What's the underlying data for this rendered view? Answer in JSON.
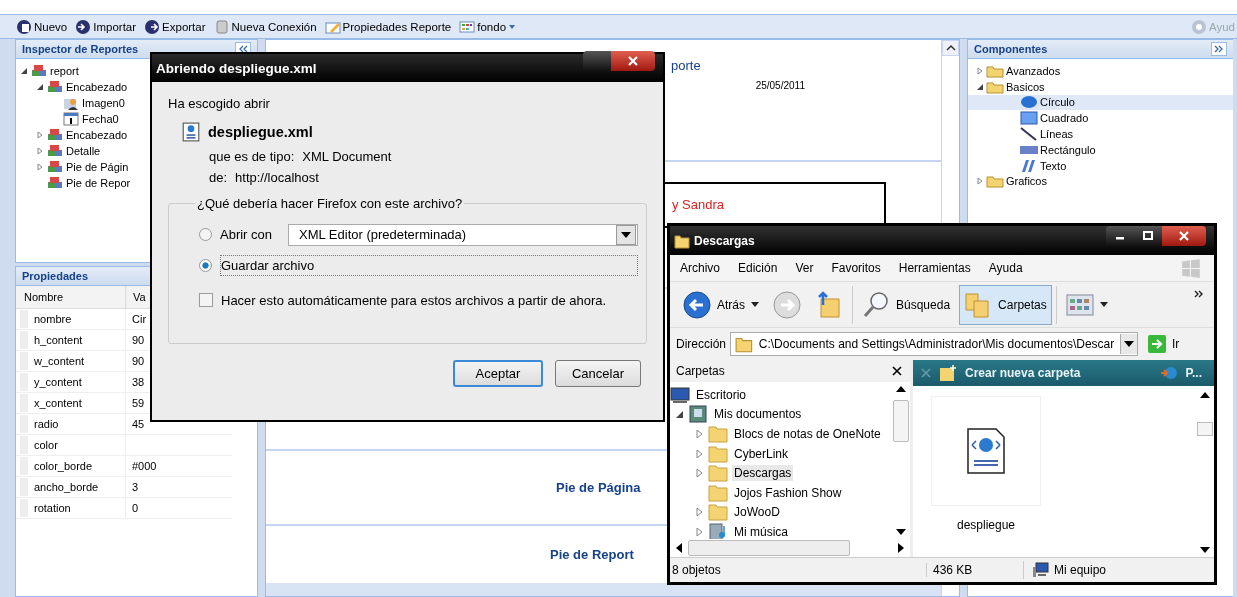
{
  "toolbar": {
    "items": [
      {
        "label": "Nuevo",
        "kind": "new"
      },
      {
        "label": "Importar",
        "kind": "import"
      },
      {
        "label": "Exportar",
        "kind": "export"
      },
      {
        "label": "Nueva Conexión",
        "kind": "connection"
      },
      {
        "label": "Propiedades Reporte",
        "kind": "properties"
      },
      {
        "label": "fondo",
        "kind": "background",
        "dropdown": true
      }
    ],
    "help": "Ayud"
  },
  "inspector": {
    "title": "Inspector de Reportes",
    "tree": [
      {
        "label": "report",
        "kind": "section",
        "expanded": true,
        "children": [
          {
            "label": "Encabezado",
            "kind": "section",
            "expanded": true,
            "children": [
              {
                "label": "Imagen0",
                "kind": "image"
              },
              {
                "label": "Fecha0",
                "kind": "date"
              }
            ]
          },
          {
            "label": "Encabezado",
            "kind": "section",
            "expanded": false
          },
          {
            "label": "Detalle",
            "kind": "section",
            "expanded": false
          },
          {
            "label": "Pie de Págin",
            "kind": "section",
            "expanded": false
          },
          {
            "label": "Pie de Repor",
            "kind": "section"
          }
        ]
      }
    ]
  },
  "properties": {
    "title": "Propiedades",
    "columns": [
      "Nombre",
      "Va"
    ],
    "rows": [
      {
        "name": "nombre",
        "value": "Cir"
      },
      {
        "name": "h_content",
        "value": "90"
      },
      {
        "name": "w_content",
        "value": "90"
      },
      {
        "name": "y_content",
        "value": "38"
      },
      {
        "name": "x_content",
        "value": "59"
      },
      {
        "name": "radio",
        "value": "45"
      },
      {
        "name": "color"
      },
      {
        "name": "color_borde",
        "value": "#000"
      },
      {
        "name": "ancho_borde",
        "value": "3"
      },
      {
        "name": "rotation",
        "value": "0"
      }
    ]
  },
  "canvas": {
    "title": "porte",
    "date": "25/05/2011",
    "box_text": "y Sandra",
    "footers": [
      "Pie de Página",
      "Pie de Report"
    ]
  },
  "components": {
    "title": "Componentes",
    "tree": [
      {
        "label": "Avanzados",
        "kind": "folder",
        "expanded": false
      },
      {
        "label": "Basicos",
        "kind": "folder",
        "expanded": true,
        "children": [
          {
            "label": "Círculo",
            "kind": "circle",
            "selected": true
          },
          {
            "label": "Cuadrado",
            "kind": "square",
            "selected": false
          },
          {
            "label": "Líneas",
            "kind": "line",
            "selected": false
          },
          {
            "label": "Rectángulo",
            "kind": "rect",
            "selected": false
          },
          {
            "label": "Texto",
            "kind": "text",
            "selected": false
          }
        ]
      },
      {
        "label": "Graficos",
        "kind": "folder",
        "expanded": false
      }
    ]
  },
  "dialog": {
    "title": "Abriendo despliegue.xml",
    "intro": "Ha escogido abrir",
    "filename": "despliegue.xml",
    "type_label": "que es de tipo:",
    "type": "XML Document",
    "from_label": "de:",
    "from": "http://localhost",
    "question": "¿Qué debería hacer Firefox con este archivo?",
    "options": [
      {
        "label": "Abrir con",
        "selected": false,
        "app": "XML Editor (predeterminada)"
      },
      {
        "label": "Guardar archivo",
        "selected": true
      }
    ],
    "auto": {
      "label": "Hacer esto automáticamente para estos archivos a partir de ahora.",
      "checked": false
    },
    "buttons": [
      {
        "label": "Aceptar",
        "default": true
      },
      {
        "label": "Cancelar",
        "default": false
      }
    ]
  },
  "explorer": {
    "title": "Descargas",
    "menu": [
      "Archivo",
      "Edición",
      "Ver",
      "Favoritos",
      "Herramientas",
      "Ayuda"
    ],
    "back": "Atrás",
    "search": "Búsqueda",
    "folders_button": {
      "label": "Carpetas",
      "selected": true
    },
    "address_label": "Dirección",
    "address": "C:\\Documents and Settings\\Administrador\\Mis documentos\\Descar",
    "go": "Ir",
    "folders_title": "Carpetas",
    "folders": [
      {
        "label": "Escritorio",
        "kind": "desktop"
      },
      {
        "label": "Mis documentos",
        "kind": "documents",
        "expanded": true,
        "children": [
          {
            "label": "Blocs de notas de OneNote",
            "kind": "folder",
            "expanded": false,
            "selected": false
          },
          {
            "label": "CyberLink",
            "kind": "folder",
            "expanded": false,
            "selected": false
          },
          {
            "label": "Descargas",
            "kind": "folder",
            "expanded": false,
            "selected": true
          },
          {
            "label": "Jojos Fashion Show",
            "kind": "folder",
            "selected": false
          },
          {
            "label": "JoWooD",
            "kind": "folder",
            "expanded": false,
            "selected": false
          },
          {
            "label": "Mi música",
            "kind": "music",
            "expanded": false,
            "selected": false
          }
        ]
      }
    ],
    "task": "Crear nueva carpeta",
    "task_more": "P...",
    "files": [
      {
        "name": "despliegue"
      }
    ],
    "status": [
      "8 objetos",
      "436 KB",
      "Mi equipo"
    ]
  }
}
